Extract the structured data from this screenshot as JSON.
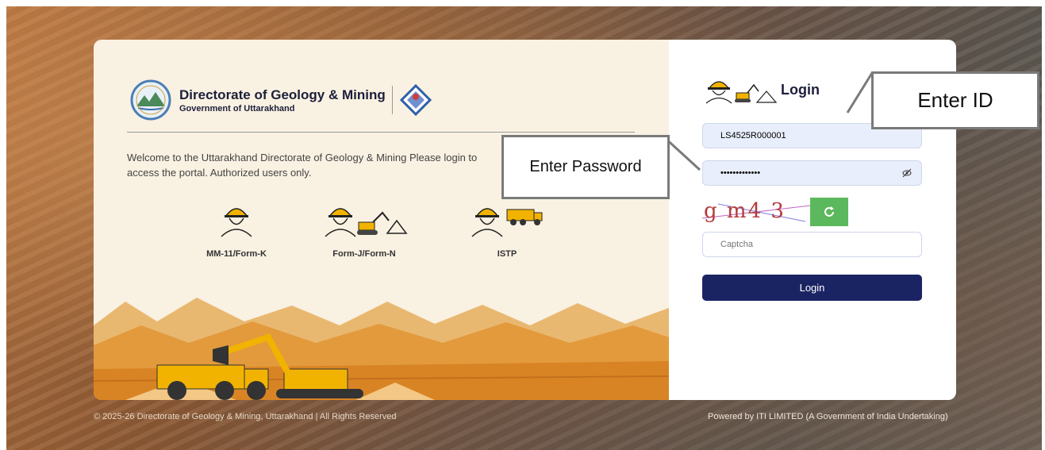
{
  "brand": {
    "title": "Directorate of Geology & Mining",
    "subtitle": "Government of Uttarakhand"
  },
  "welcome_text": "Welcome to the Uttarakhand Directorate of Geology & Mining Please login to access the portal. Authorized users only.",
  "roles": [
    {
      "label": "MM-11/Form-K",
      "icon": "miner-icon"
    },
    {
      "label": "Form-J/Form-N",
      "icon": "miner-excavator-icon"
    },
    {
      "label": "ISTP",
      "icon": "miner-truck-icon"
    }
  ],
  "login": {
    "title": "Login",
    "id_value": "LS4525R000001",
    "password_value": "•••••••••••••",
    "captcha_image_text": "g m4 3",
    "captcha_placeholder": "Captcha",
    "button_label": "Login"
  },
  "annotations": {
    "enter_id": "Enter ID",
    "enter_password": "Enter Password"
  },
  "footer": {
    "left": "© 2025-26 Directorate of Geology & Mining, Uttarakhand | All Rights Reserved",
    "right": "Powered by ITI LIMITED (A Government of India Undertaking)"
  },
  "colors": {
    "login_button": "#1b2463",
    "refresh_button": "#5cb85c",
    "field_fill": "#e8eefb"
  }
}
